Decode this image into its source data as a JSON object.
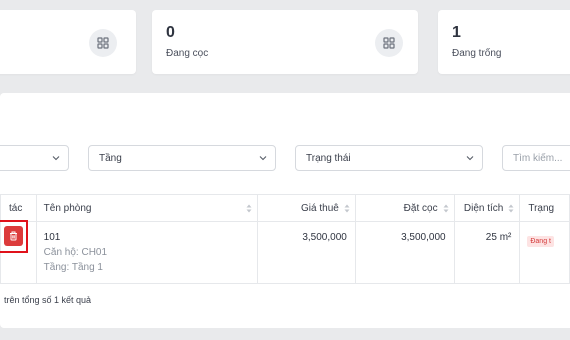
{
  "stats": [
    {
      "value": "0",
      "label": "Đang cọc",
      "icon": "grid-icon"
    },
    {
      "value": "1",
      "label": "Đang trống",
      "icon": "grid-icon"
    }
  ],
  "filters": {
    "floor_label": "Tầng",
    "status_label": "Trạng thái",
    "search_placeholder": "Tìm kiếm..."
  },
  "table": {
    "columns": {
      "action": "tác",
      "room_name": "Tên phòng",
      "rent": "Giá thuê",
      "deposit": "Đặt cọc",
      "area": "Diện tích",
      "status": "Trạng"
    },
    "rows": [
      {
        "room": "101",
        "apartment": "Căn hộ: CH01",
        "floor": "Tầng: Tầng 1",
        "rent": "3,500,000",
        "deposit": "3,500,000",
        "area": "25 m²",
        "status": "Đang t"
      }
    ]
  },
  "footer_text": "trên tổng số 1 kết quả",
  "colors": {
    "danger": "#dc3b3b",
    "highlight": "#e0121b"
  }
}
